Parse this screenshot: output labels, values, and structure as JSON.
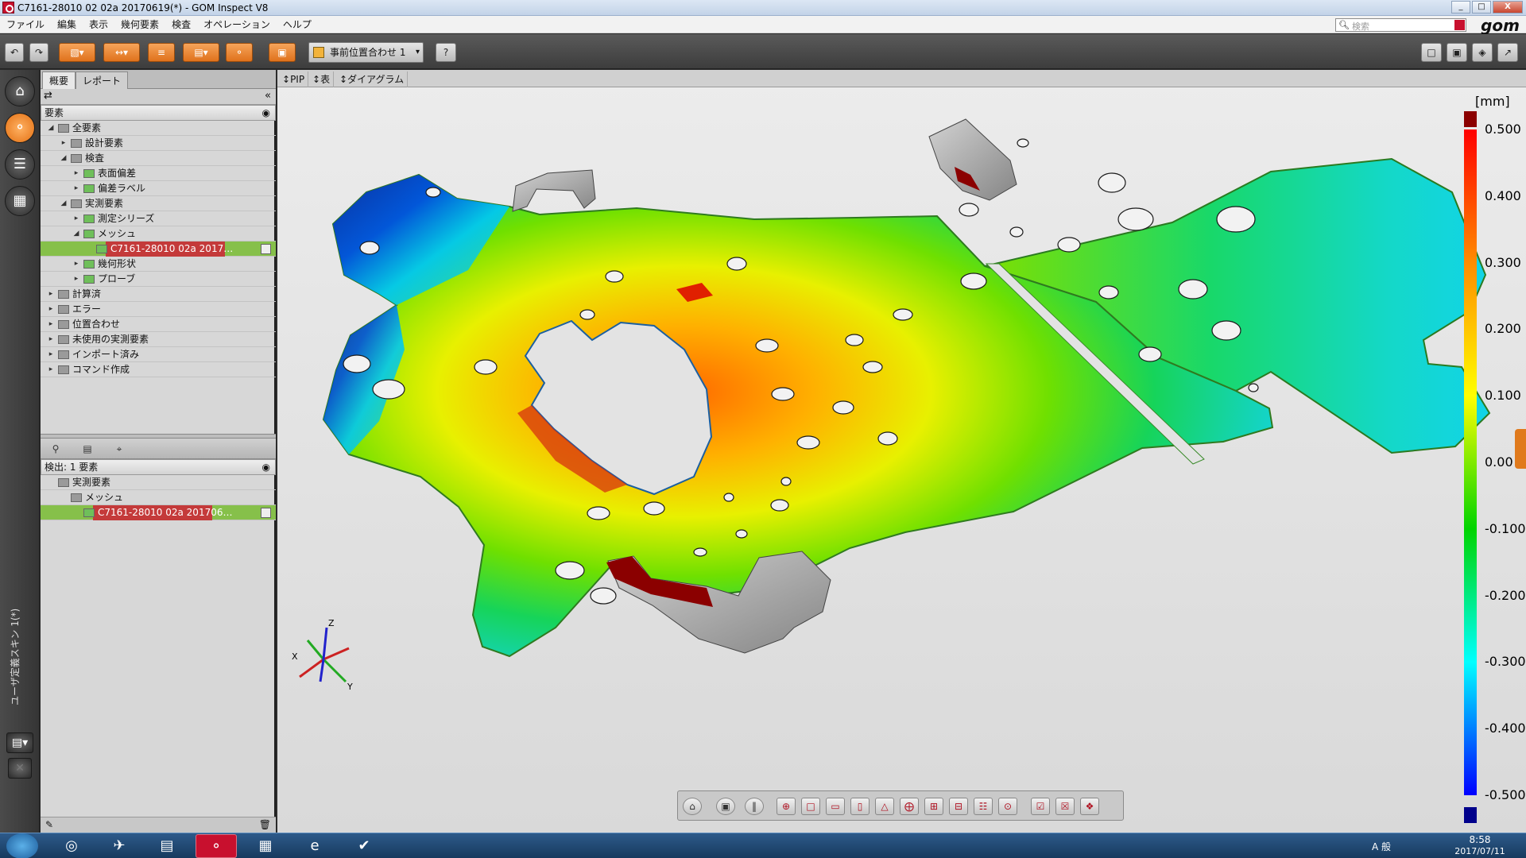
{
  "window": {
    "title": "C7161-28010 02 02a 20170619(*) - GOM Inspect V8",
    "buttons": [
      "_",
      "□",
      "X"
    ]
  },
  "menu": {
    "items": [
      "ファイル",
      "編集",
      "表示",
      "幾何要素",
      "検査",
      "オペレーション",
      "ヘルプ"
    ],
    "search_placeholder": "検索",
    "logo": "gom"
  },
  "toolbar": {
    "alignment_label": "事前位置合わせ 1",
    "help": "?"
  },
  "left_strip": {
    "vertical_label": "ユーザ定義スキン 1(*)"
  },
  "panel": {
    "tabs": [
      "概要",
      "レポート"
    ],
    "elements_header": "要素",
    "tree": [
      {
        "label": "全要素",
        "level": 0,
        "expanded": true
      },
      {
        "label": "設計要素",
        "level": 1,
        "expanded": false
      },
      {
        "label": "検査",
        "level": 1,
        "expanded": true
      },
      {
        "label": "表面偏差",
        "level": 2,
        "expanded": false
      },
      {
        "label": "偏差ラベル",
        "level": 2,
        "expanded": false
      },
      {
        "label": "実測要素",
        "level": 1,
        "expanded": true
      },
      {
        "label": "測定シリーズ",
        "level": 2,
        "expanded": false
      },
      {
        "label": "メッシュ",
        "level": 2,
        "expanded": true
      },
      {
        "label": "C7161-28010 02a 2017…",
        "level": 3,
        "selected": true
      },
      {
        "label": "幾何形状",
        "level": 2,
        "expanded": false
      },
      {
        "label": "プローブ",
        "level": 2,
        "expanded": false
      },
      {
        "label": "計算済",
        "level": 0,
        "expanded": false
      },
      {
        "label": "エラー",
        "level": 0,
        "expanded": false
      },
      {
        "label": "位置合わせ",
        "level": 0,
        "expanded": false
      },
      {
        "label": "未使用の実測要素",
        "level": 0,
        "expanded": false
      },
      {
        "label": "インポート済み",
        "level": 0,
        "expanded": false
      },
      {
        "label": "コマンド作成",
        "level": 0,
        "expanded": false
      }
    ],
    "found_header": "検出: 1 要素",
    "found_tree": [
      {
        "label": "実測要素",
        "level": 0
      },
      {
        "label": "メッシュ",
        "level": 1
      },
      {
        "label": "C7161-28010 02a 201706…",
        "level": 2,
        "selected": true
      }
    ]
  },
  "viewport": {
    "tabs": [
      "PIP",
      "表",
      "ダイアグラム"
    ],
    "axes": {
      "x": "X",
      "y": "Y",
      "z": "Z"
    }
  },
  "colorbar": {
    "unit": "[mm]",
    "ticks": [
      "0.500",
      "0.400",
      "0.300",
      "0.200",
      "0.100",
      "0.00",
      "-0.100",
      "-0.200",
      "-0.300",
      "-0.400",
      "-0.500"
    ],
    "colors": {
      "max": "#8b0000",
      "red": "#ff0000",
      "orange": "#ff8c00",
      "yellow": "#ffff00",
      "green": "#00d400",
      "cyan": "#00ffff",
      "blue": "#0000ff",
      "min": "#00008b"
    }
  },
  "taskbar": {
    "ime": "A 般",
    "time": "8:58",
    "date": "2017/07/11"
  }
}
